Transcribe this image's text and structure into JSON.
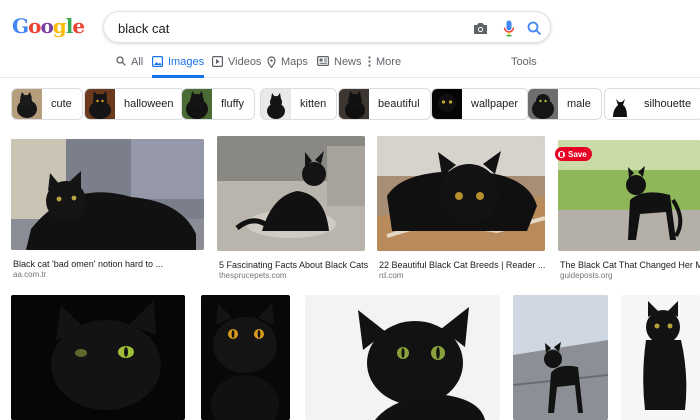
{
  "search": {
    "query": "black cat"
  },
  "tabs": [
    {
      "label": "All",
      "icon": "search-icon"
    },
    {
      "label": "Images",
      "icon": "image-icon"
    },
    {
      "label": "Videos",
      "icon": "video-icon"
    },
    {
      "label": "Maps",
      "icon": "map-pin-icon"
    },
    {
      "label": "News",
      "icon": "news-icon"
    },
    {
      "label": "More",
      "icon": "more-vert-icon"
    },
    {
      "label": "Tools"
    }
  ],
  "chips": [
    {
      "label": "cute"
    },
    {
      "label": "halloween"
    },
    {
      "label": "fluffy"
    },
    {
      "label": "kitten"
    },
    {
      "label": "beautiful"
    },
    {
      "label": "wallpaper"
    },
    {
      "label": "male"
    },
    {
      "label": "silhouette"
    }
  ],
  "results_row1": [
    {
      "caption": "Black cat 'bad omen' notion hard to ...",
      "source": "aa.com.tr"
    },
    {
      "caption": "5 Fascinating Facts About Black Cats",
      "source": "thesprucepets.com"
    },
    {
      "caption": "22 Beautiful Black Cat Breeds | Reader ...",
      "source": "rd.com"
    },
    {
      "caption": "The Black Cat That Changed Her Mind",
      "source": "guideposts.org"
    }
  ],
  "save_label": "Save",
  "colors": {
    "accent": "#1a73e8",
    "pinterest": "#e60023"
  }
}
